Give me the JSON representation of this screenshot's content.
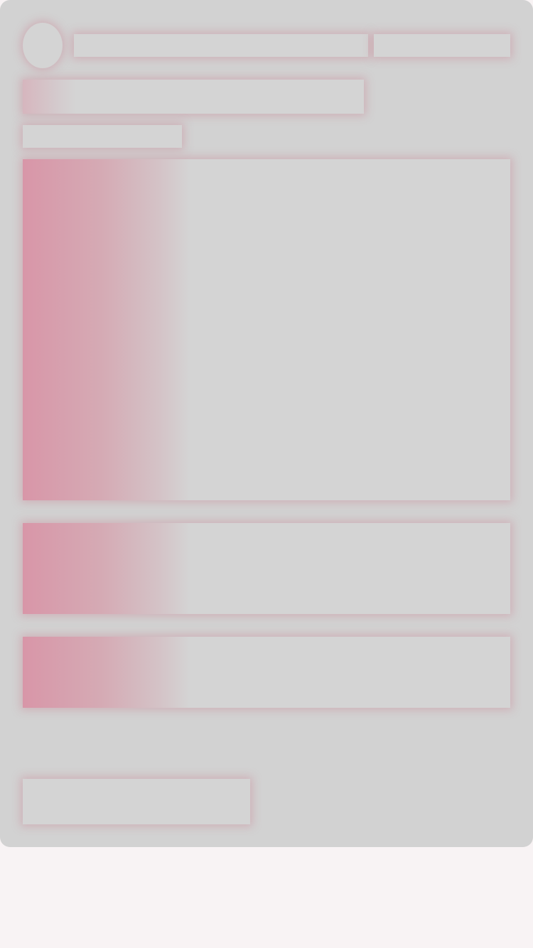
{
  "screen": {
    "state": "loading-skeleton",
    "background_color": "#f8f3f4",
    "card_color": "#d2d2d2",
    "placeholder_color": "#d4d4d4",
    "shimmer_color": "#d896a8"
  },
  "placeholders": [
    {
      "role": "avatar"
    },
    {
      "role": "title-line"
    },
    {
      "role": "meta-line"
    },
    {
      "role": "headline"
    },
    {
      "role": "subline"
    },
    {
      "role": "media"
    },
    {
      "role": "content-block"
    },
    {
      "role": "content-block"
    },
    {
      "role": "action-button"
    }
  ]
}
